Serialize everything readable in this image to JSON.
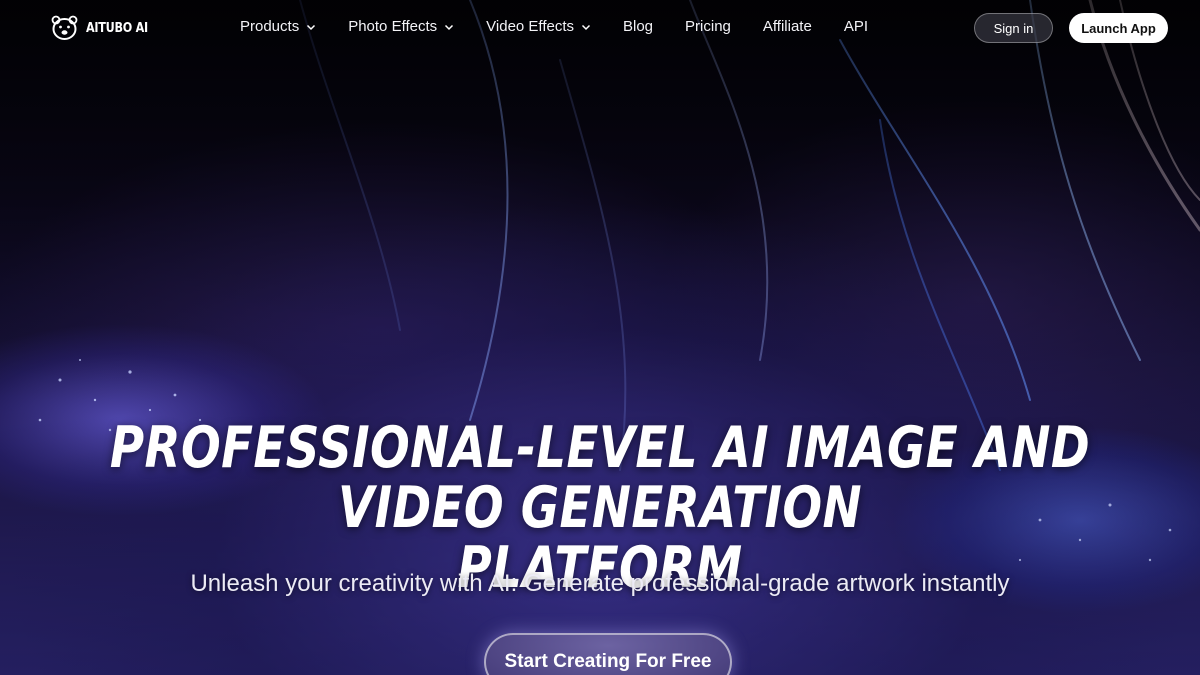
{
  "brand": {
    "logo_text": "AITUBO AI",
    "logo_icon": "bear-head-icon"
  },
  "nav": {
    "items": [
      {
        "label": "Products",
        "has_dropdown": true
      },
      {
        "label": "Photo Effects",
        "has_dropdown": true
      },
      {
        "label": "Video Effects",
        "has_dropdown": true
      },
      {
        "label": "Blog",
        "has_dropdown": false
      },
      {
        "label": "Pricing",
        "has_dropdown": false
      },
      {
        "label": "Affiliate",
        "has_dropdown": false
      },
      {
        "label": "API",
        "has_dropdown": false
      }
    ],
    "sign_in_label": "Sign in",
    "launch_label": "Launch App"
  },
  "hero": {
    "title_line1": "PROFESSIONAL-LEVEL AI IMAGE AND VIDEO GENERATION",
    "title_line2": "PLATFORM",
    "subtitle": "Unleash your creativity with AI: Generate professional-grade artwork instantly",
    "cta_label": "Start Creating For Free"
  },
  "colors": {
    "background": "#05040c",
    "accent_glow": "#7a6eff",
    "button_light": "#ffffff"
  }
}
